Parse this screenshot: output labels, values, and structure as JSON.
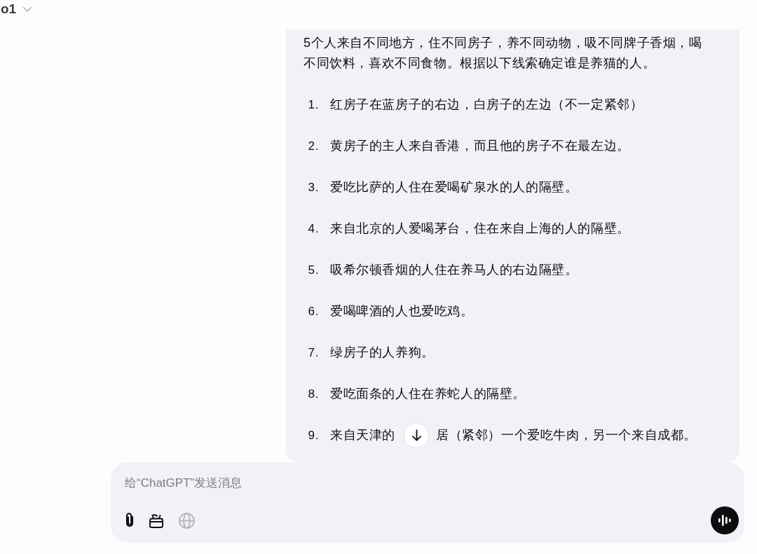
{
  "header": {
    "model": "o1"
  },
  "message": {
    "intro": "5个人来自不同地方，住不同房子，养不同动物，吸不同牌子香烟，喝不同饮料，喜欢不同食物。根据以下线索确定谁是养猫的人。",
    "clues": [
      {
        "number": "1.",
        "text": "红房子在蓝房子的右边，白房子的左边（不一定紧邻）"
      },
      {
        "number": "2.",
        "text": "黄房子的主人来自香港，而且他的房子不在最左边。"
      },
      {
        "number": "3.",
        "text": "爱吃比萨的人住在爱喝矿泉水的人的隔壁。"
      },
      {
        "number": "4.",
        "text": "来自北京的人爱喝茅台，住在来自上海的人的隔壁。"
      },
      {
        "number": "5.",
        "text": "吸希尔顿香烟的人住在养马人的右边隔壁。"
      },
      {
        "number": "6.",
        "text": "爱喝啤酒的人也爱吃鸡。"
      },
      {
        "number": "7.",
        "text": "绿房子的人养狗。"
      },
      {
        "number": "8.",
        "text": "爱吃面条的人住在养蛇人的隔壁。"
      },
      {
        "number": "9.",
        "text": "来自天津的",
        "text_after": "居（紧邻）一个爱吃牛肉，另一个来自成都。"
      }
    ]
  },
  "composer": {
    "placeholder": "给“ChatGPT”发送消息",
    "tools": [
      {
        "kind": "attach",
        "disabled": false
      },
      {
        "kind": "tools",
        "disabled": false
      },
      {
        "kind": "web",
        "disabled": true
      }
    ]
  }
}
